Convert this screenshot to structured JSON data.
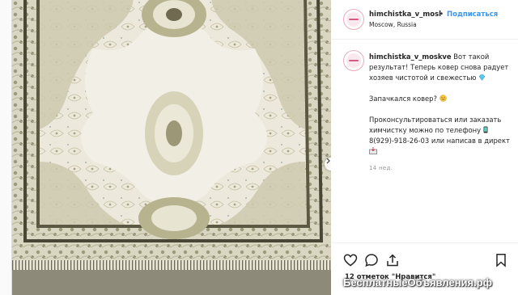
{
  "post": {
    "username": "himchistka_v_mosl",
    "separator": "•",
    "follow_label": "Подписаться",
    "location": "Moscow, Russia"
  },
  "caption": {
    "username": "himchistka_v_moskve",
    "line1": "Вот такой результат! Теперь ковер снова радует хозяев чистотой и свежестью",
    "line2": "Запачкался ковер?",
    "line3": "Проконсультироваться или заказать химчистку можно по телефону",
    "phone": "8(929)-918-26-03",
    "line3_end": "или написав в директ",
    "time": "14 нед."
  },
  "actions": {
    "likes_text": "12 отметок \"Нравится\""
  },
  "icons": {
    "like": "heart-icon",
    "comment": "comment-icon",
    "share": "share-icon",
    "save": "bookmark-icon",
    "next": "chevron-right-icon"
  },
  "watermark": "БесплатныеОбъявления.рф",
  "colors": {
    "link": "#3897f0",
    "text": "#262626",
    "muted": "#999999",
    "avatar_ring": "#e8aebd"
  }
}
